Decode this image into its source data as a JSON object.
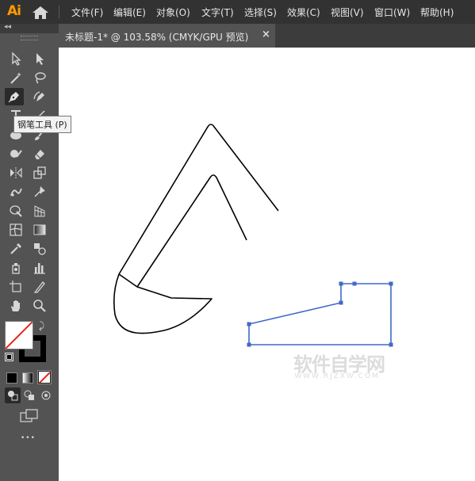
{
  "app": {
    "logo": "Ai"
  },
  "menu": [
    {
      "id": "file",
      "label": "文件(F)"
    },
    {
      "id": "edit",
      "label": "编辑(E)"
    },
    {
      "id": "object",
      "label": "对象(O)"
    },
    {
      "id": "type",
      "label": "文字(T)"
    },
    {
      "id": "select",
      "label": "选择(S)"
    },
    {
      "id": "effect",
      "label": "效果(C)"
    },
    {
      "id": "view",
      "label": "视图(V)"
    },
    {
      "id": "window",
      "label": "窗口(W)"
    },
    {
      "id": "help",
      "label": "帮助(H)"
    }
  ],
  "document": {
    "tab_title": "未标题-1* @ 103.58% (CMYK/GPU 预览)",
    "close_glyph": "×"
  },
  "tooltip": {
    "text": "钢笔工具 (P)"
  },
  "toolbar": {
    "collapse_glyph": "◂◂",
    "more_glyph": "•••"
  },
  "colors": {
    "fill": "#ffffff",
    "stroke": "#000000",
    "selection": "#4169c8",
    "accent": "#ff9a00"
  },
  "watermark": {
    "main": "软件自学网",
    "sub": "WWW.RJZXW.COM"
  }
}
